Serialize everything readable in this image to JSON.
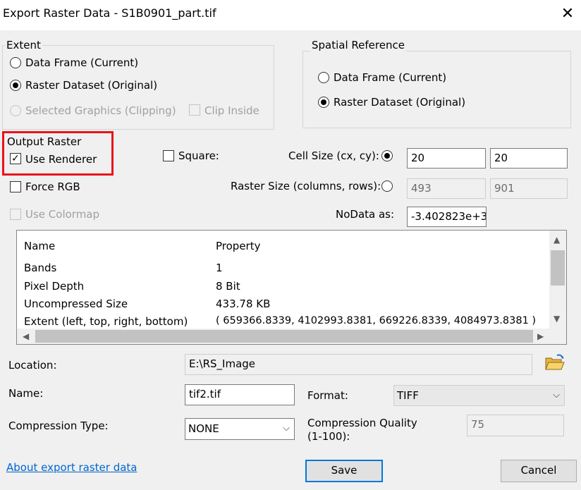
{
  "window": {
    "title": "Export Raster Data - S1B0901_part.tif",
    "close_glyph": "✕"
  },
  "extent": {
    "label": "Extent",
    "data_frame": "Data Frame (Current)",
    "raster_dataset": "Raster Dataset (Original)",
    "selected_graphics": "Selected Graphics (Clipping)",
    "clip_inside": "Clip Inside",
    "selected": "raster_dataset"
  },
  "spatial_reference": {
    "label": "Spatial Reference",
    "data_frame": "Data Frame (Current)",
    "raster_dataset": "Raster Dataset (Original)",
    "selected": "raster_dataset"
  },
  "output_raster": {
    "label": "Output Raster",
    "use_renderer": "Use Renderer",
    "use_renderer_checked": true,
    "force_rgb": "Force RGB",
    "use_colormap": "Use Colormap",
    "square": "Square:",
    "cell_size_label": "Cell Size (cx, cy):",
    "cell_size_cx": "20",
    "cell_size_cy": "20",
    "raster_size_label": "Raster Size (columns, rows):",
    "raster_columns": "493",
    "raster_rows": "901",
    "nodata_label": "NoData as:",
    "nodata_value": "-3.402823e+3"
  },
  "properties": {
    "headers": [
      "Name",
      "Property"
    ],
    "rows": [
      [
        "Bands",
        "1"
      ],
      [
        "Pixel Depth",
        "8 Bit"
      ],
      [
        "Uncompressed Size",
        "433.78 KB"
      ],
      [
        "Extent (left, top, right, bottom)",
        "( 659366.8339, 4102993.8381, 669226.8339, 4084973.8381 )"
      ]
    ]
  },
  "location": {
    "label": "Location:",
    "value": "E:\\RS_Image"
  },
  "name": {
    "label": "Name:",
    "value": "tif2.tif"
  },
  "format": {
    "label": "Format:",
    "value": "TIFF"
  },
  "compression": {
    "type_label": "Compression Type:",
    "type_value": "NONE",
    "quality_label_1": "Compression Quality",
    "quality_label_2": "(1-100):",
    "quality_value": "75"
  },
  "footer": {
    "about_link": "About export raster data",
    "save": "Save",
    "cancel": "Cancel"
  },
  "colors": {
    "highlight": "#e8131b",
    "accent": "#0078d7",
    "link": "#0066cc"
  }
}
